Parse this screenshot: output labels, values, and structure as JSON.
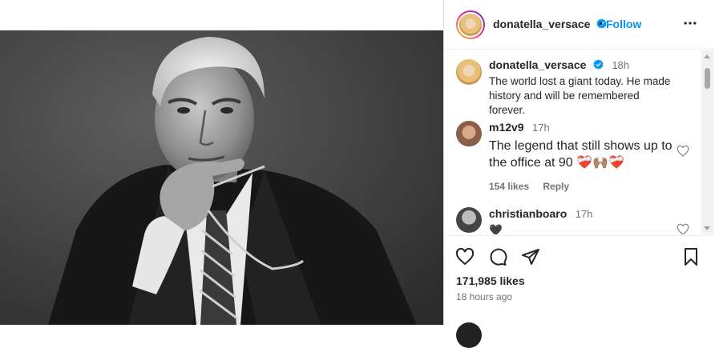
{
  "post": {
    "author": "donatella_versace",
    "follow_label": "Follow",
    "separator": "•",
    "likes": "171,985 likes",
    "time_ago": "18 hours ago"
  },
  "comments": [
    {
      "user": "donatella_versace",
      "time": "18h",
      "text": "The world lost a giant today. He made history and will be remembered forever.",
      "verified": true
    },
    {
      "user": "m12v9",
      "time": "17h",
      "text": "The legend that still shows up to the office at 90 ❤️‍🩹🙌🏽❤️‍🩹",
      "likes": "154 likes",
      "reply": "Reply"
    },
    {
      "user": "christianboaro",
      "time": "17h",
      "text": "🖤"
    }
  ],
  "colors": {
    "accent": "#0095f6",
    "text": "#262626",
    "muted": "#737373",
    "border": "#dbdbdb"
  },
  "icons": {
    "like": "heart-icon",
    "comment": "comment-icon",
    "share": "send-icon",
    "save": "bookmark-icon",
    "more": "more-options-icon",
    "verified": "verified-badge-icon"
  }
}
